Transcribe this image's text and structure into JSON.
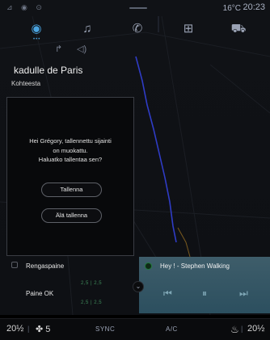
{
  "status": {
    "temperature": "16°C",
    "clock": "20:23",
    "left_icons": "⊿ ◉ ⊙"
  },
  "nav": {
    "items": [
      {
        "name": "navigation",
        "glyph": "◉"
      },
      {
        "name": "music",
        "glyph": "♫"
      },
      {
        "name": "phone",
        "glyph": "✆"
      },
      {
        "name": "apps",
        "glyph": "⊞"
      },
      {
        "name": "vehicle",
        "glyph": "⛟"
      }
    ],
    "active_dots": "•••"
  },
  "subnav": {
    "left_glyph": "↱",
    "right_glyph": "◁)"
  },
  "header": {
    "title": "kadulle  de Paris",
    "subtitle": "Kohteesta"
  },
  "dialog": {
    "lines": [
      "Hei Grégory, tallennettu sijainti",
      "on muokattu.",
      "Haluatko tallentaa sen?"
    ],
    "save_label": "Tallenna",
    "dont_save_label": "Älä tallenna"
  },
  "tyres": {
    "label": "Rengaspaine",
    "status": "Paine OK",
    "front": "2,5  |  2,5",
    "rear": "2,5  |  2,5"
  },
  "media": {
    "song": "Hey ! - Stephen Walking",
    "prev": "⏮",
    "pause": "⏸",
    "next": "⏭"
  },
  "bottom_bar": {
    "left_temp": "20",
    "left_temp_suffix": "½",
    "fan": "✤ 5",
    "sync": "SYNC",
    "ac": "A/C",
    "right_temp": "20",
    "right_temp_suffix": "½",
    "seat_icon": "♨"
  },
  "colors": {
    "accent": "#4aa3df",
    "route": "#2f3cc6",
    "ok_green": "#3e8a5a"
  }
}
